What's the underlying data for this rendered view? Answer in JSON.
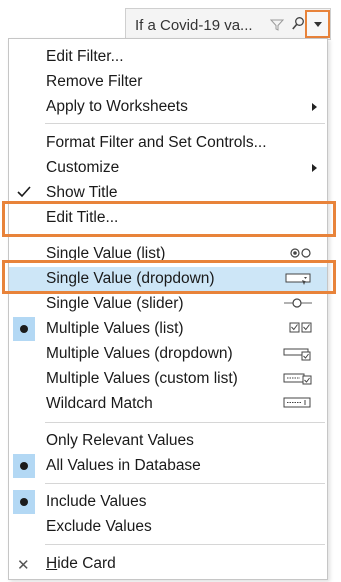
{
  "header": {
    "title": "If a Covid-19 va...",
    "icons": [
      "funnel-icon",
      "search-icon",
      "chevron-down-icon"
    ]
  },
  "menu": {
    "edit_filter": "Edit Filter...",
    "remove_filter": "Remove Filter",
    "apply_to_worksheets": "Apply to Worksheets",
    "format_filter": "Format Filter and Set Controls...",
    "customize": "Customize",
    "show_title": "Show Title",
    "edit_title": "Edit Title...",
    "single_value_list": "Single Value (list)",
    "single_value_dropdown": "Single Value (dropdown)",
    "single_value_slider": "Single Value (slider)",
    "multiple_values_list": "Multiple Values (list)",
    "multiple_values_dropdown": "Multiple Values (dropdown)",
    "multiple_values_custom": "Multiple Values (custom list)",
    "wildcard_match": "Wildcard Match",
    "only_relevant": "Only Relevant Values",
    "all_values": "All Values in Database",
    "include_values": "Include Values",
    "exclude_values": "Exclude Values",
    "hide_card": "Hide Card"
  },
  "state": {
    "show_title_checked": true,
    "selected_mode": "Multiple Values (list)",
    "selected_scope": "All Values in Database",
    "selected_include": "Include Values"
  },
  "colors": {
    "highlight_outline": "#e8833a",
    "hover_bg": "#cde6f7",
    "selected_marker_bg": "#b3d8f4"
  }
}
